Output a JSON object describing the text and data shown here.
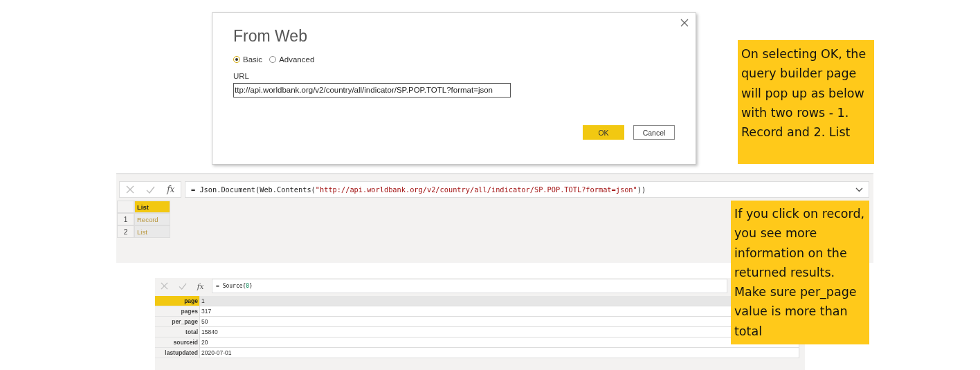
{
  "dialog": {
    "title": "From Web",
    "modes": [
      {
        "label": "Basic",
        "selected": true
      },
      {
        "label": "Advanced",
        "selected": false
      }
    ],
    "url_label": "URL",
    "url_value": "ttp://api.worldbank.org/v2/country/all/indicator/SP.POP.TOTL?format=json",
    "buttons": [
      {
        "label": "OK",
        "kind": "primary"
      },
      {
        "label": "Cancel",
        "kind": "secondary"
      }
    ]
  },
  "note_1": "On selecting OK, the query builder page will pop up as below with two rows - 1. Record and 2. List",
  "query_editor": {
    "fx": "fx",
    "formula": [
      {
        "text": "= Json.Document(Web.Contents(",
        "kind": "code"
      },
      {
        "text": "\"http://api.worldbank.org/v2/country/all/indicator/SP.POP.TOTL?format=json\"",
        "kind": "string"
      },
      {
        "text": "))",
        "kind": "code"
      }
    ],
    "table": {
      "column": {
        "label": "List",
        "selected": true
      },
      "rows": [
        {
          "index": "1",
          "value": "Record"
        },
        {
          "index": "2",
          "value": "List"
        }
      ]
    }
  },
  "note_2": "If you click on record, you see more information on the returned results. Make sure per_page value is more than total",
  "record_view": {
    "fx": "fx",
    "formula": [
      {
        "text": "= Source{",
        "kind": "code"
      },
      {
        "text": "0",
        "kind": "number"
      },
      {
        "text": "}",
        "kind": "code"
      }
    ],
    "rows": [
      {
        "field": "page",
        "value": "1",
        "selected": true
      },
      {
        "field": "pages",
        "value": "317",
        "selected": false
      },
      {
        "field": "per_page",
        "value": "50",
        "selected": false
      },
      {
        "field": "total",
        "value": "15840",
        "selected": false
      },
      {
        "field": "sourceid",
        "value": "20",
        "selected": false
      },
      {
        "field": "lastupdated",
        "value": "2020-07-01",
        "selected": false
      }
    ]
  }
}
